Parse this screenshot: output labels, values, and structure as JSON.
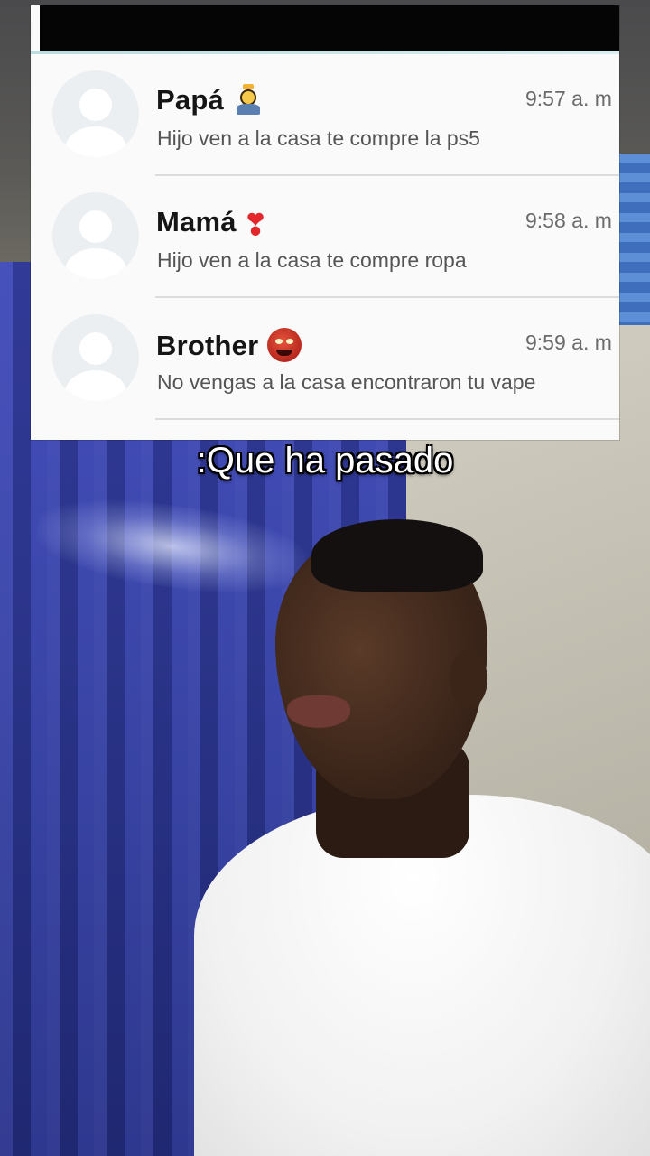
{
  "chats": [
    {
      "name": "Papá",
      "emoji": "woman-with-crown-icon",
      "time": "9:57 a. m",
      "preview": "Hijo ven a la casa te compre la ps5"
    },
    {
      "name": "Mamá",
      "emoji": "heart-exclamation-icon",
      "time": "9:58 a. m",
      "preview": "Hijo ven a la casa te compre ropa"
    },
    {
      "name": "Brother",
      "emoji": "ogre-icon",
      "time": "9:59 a. m",
      "preview": "No vengas a la casa encontraron tu vape"
    }
  ],
  "caption": ":Que ha pasado",
  "colors": {
    "curtain": "#3440a8",
    "wall": "#c4c0b3",
    "shirt": "#f1f1f1",
    "card_bg": "#fafafa"
  }
}
